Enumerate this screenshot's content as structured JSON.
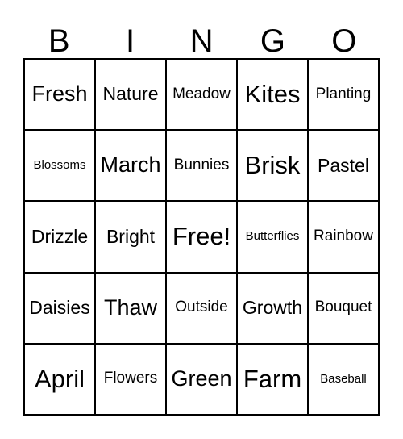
{
  "card": {
    "type": "bingo-card",
    "columns": 5,
    "rows": 5,
    "background_color": "#ffffff",
    "text_color": "#000000",
    "border_color": "#000000",
    "header": {
      "letters": [
        "B",
        "I",
        "N",
        "G",
        "O"
      ]
    },
    "free_space": {
      "label": "Free!",
      "row": 3,
      "column": 3
    },
    "rows_data": [
      [
        {
          "label": "Fresh",
          "size": "lg"
        },
        {
          "label": "Nature",
          "size": "md"
        },
        {
          "label": "Meadow",
          "size": "sm"
        },
        {
          "label": "Kites",
          "size": "xl"
        },
        {
          "label": "Planting",
          "size": "sm"
        }
      ],
      [
        {
          "label": "Blossoms",
          "size": "xs"
        },
        {
          "label": "March",
          "size": "lg"
        },
        {
          "label": "Bunnies",
          "size": "sm"
        },
        {
          "label": "Brisk",
          "size": "xl"
        },
        {
          "label": "Pastel",
          "size": "md"
        }
      ],
      [
        {
          "label": "Drizzle",
          "size": "md"
        },
        {
          "label": "Bright",
          "size": "md"
        },
        {
          "label": "Free!",
          "size": "xl"
        },
        {
          "label": "Butterflies",
          "size": "xs"
        },
        {
          "label": "Rainbow",
          "size": "sm"
        }
      ],
      [
        {
          "label": "Daisies",
          "size": "md"
        },
        {
          "label": "Thaw",
          "size": "lg"
        },
        {
          "label": "Outside",
          "size": "sm"
        },
        {
          "label": "Growth",
          "size": "md"
        },
        {
          "label": "Bouquet",
          "size": "sm"
        }
      ],
      [
        {
          "label": "April",
          "size": "xl"
        },
        {
          "label": "Flowers",
          "size": "sm"
        },
        {
          "label": "Green",
          "size": "lg"
        },
        {
          "label": "Farm",
          "size": "xl"
        },
        {
          "label": "Baseball",
          "size": "xs"
        }
      ]
    ]
  }
}
